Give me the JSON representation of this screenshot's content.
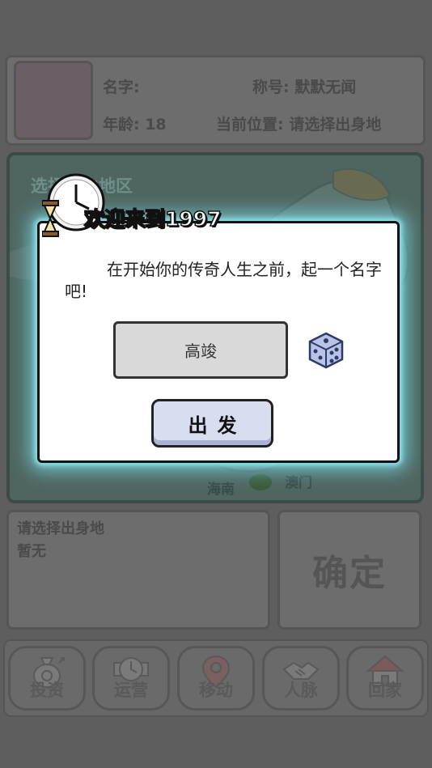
{
  "profile": {
    "name_label": "名字:",
    "title_label": "称号: 默默无闻",
    "age_label": "年龄: 18",
    "location_label": "当前位置: 请选择出身地"
  },
  "map": {
    "title": "选择出生地区",
    "labels": {
      "hainan": "海南",
      "macau": "澳门"
    }
  },
  "info": {
    "line1": "请选择出身地",
    "line2": "暂无"
  },
  "confirm_label": "确定",
  "nav": [
    {
      "label": "投资",
      "icon": "money-bag-icon"
    },
    {
      "label": "运营",
      "icon": "clock-document-icon"
    },
    {
      "label": "移动",
      "icon": "map-pin-icon"
    },
    {
      "label": "人脉",
      "icon": "handshake-icon"
    },
    {
      "label": "回家",
      "icon": "house-icon"
    }
  ],
  "dialog": {
    "title": "欢迎来到1997",
    "message": "在开始你的传奇人生之前，起一个名字吧!",
    "name_value": "高竣",
    "go_label": "出发"
  },
  "colors": {
    "dialog_glow": "#78dceb",
    "go_button": "#d8ddf0",
    "input_bg": "#d9d9d9",
    "dice": "#9aa8d8"
  }
}
